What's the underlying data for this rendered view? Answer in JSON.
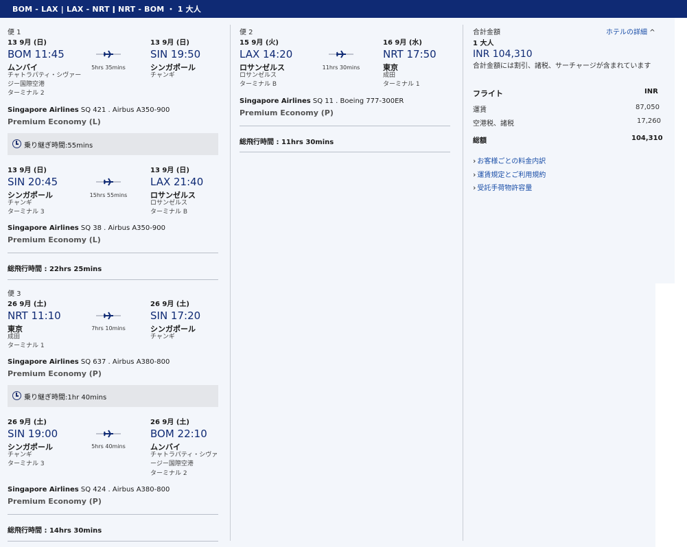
{
  "header": {
    "route": "BOM - LAX | LAX - NRT ǀ NRT - BOM ・ 1 大人"
  },
  "flight1": {
    "label": "便 1",
    "seg1": {
      "dep_date": "13 9月 (日)",
      "dep_time": "BOM 11:45",
      "dep_city": "ムンバイ",
      "dep_place": "チャトラパティ・シヴァージー国際空港",
      "dep_terminal": "ターミナル 2",
      "duration": "5hrs 35mins",
      "arr_date": "13 9月 (日)",
      "arr_time": "SIN 19:50",
      "arr_city": "シンガポール",
      "arr_place": "チャンギ",
      "airline": "Singapore Airlines",
      "flight_info": "SQ 421 . Airbus A350-900",
      "cabin": "Premium Economy (L)"
    },
    "layover": "乗り継ぎ時間:55mins",
    "seg2": {
      "dep_date": "13 9月 (日)",
      "dep_time": "SIN 20:45",
      "dep_city": "シンガポール",
      "dep_place": "チャンギ",
      "dep_terminal": "ターミナル 3",
      "duration": "15hrs 55mins",
      "arr_date": "13 9月 (日)",
      "arr_time": "LAX 21:40",
      "arr_city": "ロサンゼルス",
      "arr_place": "ロサンゼルス",
      "arr_terminal": "ターミナル B",
      "airline": "Singapore Airlines",
      "flight_info": "SQ 38 . Airbus A350-900",
      "cabin": "Premium Economy (L)"
    },
    "total": "総飛行時間 : 22hrs 25mins"
  },
  "flight2": {
    "label": "便 2",
    "seg1": {
      "dep_date": "15 9月 (火)",
      "dep_time": "LAX 14:20",
      "dep_city": "ロサンゼルス",
      "dep_place": "ロサンゼルス",
      "dep_terminal": "ターミナル B",
      "duration": "11hrs 30mins",
      "arr_date": "16 9月 (水)",
      "arr_time": "NRT 17:50",
      "arr_city": "東京",
      "arr_place": "成田",
      "arr_terminal": "ターミナル 1",
      "airline": "Singapore Airlines",
      "flight_info": "SQ 11 . Boeing 777-300ER",
      "cabin": "Premium Economy (P)"
    },
    "total": "総飛行時間 : 11hrs 30mins"
  },
  "flight3": {
    "label": "便 3",
    "seg1": {
      "dep_date": "26 9月 (土)",
      "dep_time": "NRT 11:10",
      "dep_city": "東京",
      "dep_place": "成田",
      "dep_terminal": "ターミナル 1",
      "duration": "7hrs 10mins",
      "arr_date": "26 9月 (土)",
      "arr_time": "SIN 17:20",
      "arr_city": "シンガポール",
      "arr_place": "チャンギ",
      "airline": "Singapore Airlines",
      "flight_info": "SQ 637 . Airbus A380-800",
      "cabin": "Premium Economy (P)"
    },
    "layover": "乗り継ぎ時間:1hr 40mins",
    "seg2": {
      "dep_date": "26 9月 (土)",
      "dep_time": "SIN 19:00",
      "dep_city": "シンガポール",
      "dep_place": "チャンギ",
      "dep_terminal": "ターミナル 3",
      "duration": "5hrs 40mins",
      "arr_date": "26 9月 (土)",
      "arr_time": "BOM 22:10",
      "arr_city": "ムンバイ",
      "arr_place": "チャトラパティ・シヴァージー国際空港",
      "arr_terminal": "ターミナル 2",
      "airline": "Singapore Airlines",
      "flight_info": "SQ 424 . Airbus A380-800",
      "cabin": "Premium Economy (P)"
    },
    "total": "総飛行時間 : 14hrs 30mins"
  },
  "summary": {
    "title": "合計金額",
    "hotel_link": "ホテルの詳細",
    "pax": "1 大人",
    "amount": "INR 104,310",
    "note": "合計金額には割引、諸税、サーチャージが含まれています",
    "flight_label": "フライト",
    "currency": "INR",
    "fare_label": "運賃",
    "fare_value": "87,050",
    "tax_label": "空港税、諸税",
    "tax_value": "17,260",
    "total_label": "総額",
    "total_value": "104,310",
    "links": [
      "お客様ごとの料金内訳",
      "運賃規定とご利用規約",
      "受託手荷物許容量"
    ]
  },
  "colors": {
    "brand": "#0f2a74",
    "link": "#1b4fa8",
    "panel": "#f3f6fb"
  }
}
